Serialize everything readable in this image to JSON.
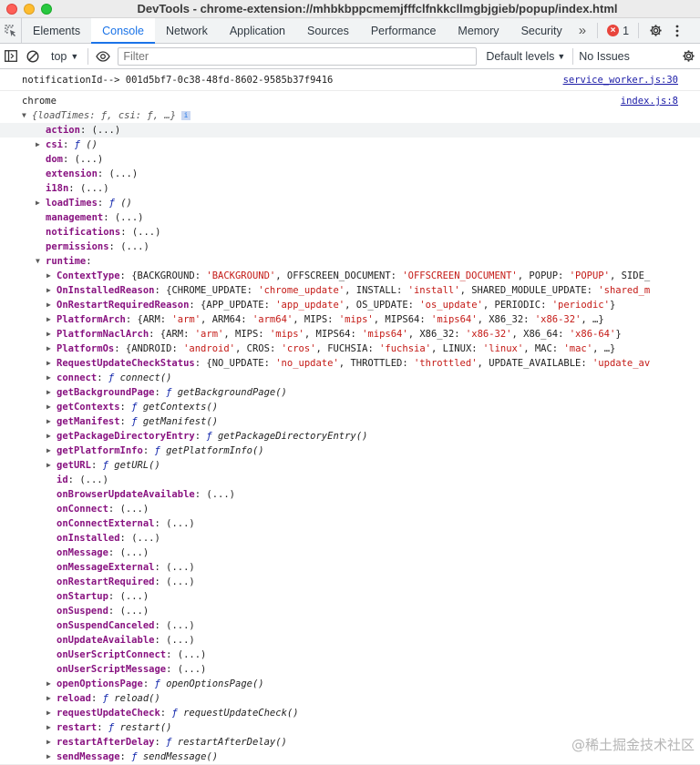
{
  "window": {
    "title": "DevTools - chrome-extension://mhbkbppcmemjfffclfnkkcllmgbjgieb/popup/index.html"
  },
  "tabs": {
    "items": [
      {
        "label": "Elements"
      },
      {
        "label": "Console"
      },
      {
        "label": "Network"
      },
      {
        "label": "Application"
      },
      {
        "label": "Sources"
      },
      {
        "label": "Performance"
      },
      {
        "label": "Memory"
      },
      {
        "label": "Security"
      }
    ],
    "more": "»",
    "error_count": "1"
  },
  "toolbar": {
    "context": "top",
    "filter_placeholder": "Filter",
    "levels": "Default levels",
    "issues": "No Issues"
  },
  "messages": [
    {
      "text": "notificationId--> 001d5bf7-0c38-48fd-8602-9585b37f9416",
      "source": "service_worker.js:30"
    },
    {
      "text": "chrome",
      "source": "index.js:8"
    }
  ],
  "object_summary": "{loadTimes: ƒ, csi: ƒ, …}",
  "chrome_props": [
    {
      "key": "action",
      "rest": ": (...)",
      "expandable": false
    },
    {
      "key": "csi",
      "rest": ": ƒ ()",
      "expandable": true,
      "fn": true
    },
    {
      "key": "dom",
      "rest": ": (...)",
      "expandable": false
    },
    {
      "key": "extension",
      "rest": ": (...)",
      "expandable": false
    },
    {
      "key": "i18n",
      "rest": ": (...)",
      "expandable": false
    },
    {
      "key": "loadTimes",
      "rest": ": ƒ ()",
      "expandable": true,
      "fn": true
    },
    {
      "key": "management",
      "rest": ": (...)",
      "expandable": false
    },
    {
      "key": "notifications",
      "rest": ": (...)",
      "expandable": false
    },
    {
      "key": "permissions",
      "rest": ": (...)",
      "expandable": false
    },
    {
      "key": "runtime",
      "rest": ":",
      "expandable": true,
      "open": true
    }
  ],
  "runtime_enums": [
    {
      "key": "ContextType",
      "pairs": [
        [
          "BACKGROUND",
          "'BACKGROUND'"
        ],
        [
          "OFFSCREEN_DOCUMENT",
          "'OFFSCREEN_DOCUMENT'"
        ],
        [
          "POPUP",
          "'POPUP'"
        ],
        [
          "SIDE_",
          ""
        ]
      ]
    },
    {
      "key": "OnInstalledReason",
      "pairs": [
        [
          "CHROME_UPDATE",
          "'chrome_update'"
        ],
        [
          "INSTALL",
          "'install'"
        ],
        [
          "SHARED_MODULE_UPDATE",
          "'shared_m"
        ]
      ]
    },
    {
      "key": "OnRestartRequiredReason",
      "pairs": [
        [
          "APP_UPDATE",
          "'app_update'"
        ],
        [
          "OS_UPDATE",
          "'os_update'"
        ],
        [
          "PERIODIC",
          "'periodic'"
        ]
      ],
      "close": "}"
    },
    {
      "key": "PlatformArch",
      "pairs": [
        [
          "ARM",
          "'arm'"
        ],
        [
          "ARM64",
          "'arm64'"
        ],
        [
          "MIPS",
          "'mips'"
        ],
        [
          "MIPS64",
          "'mips64'"
        ],
        [
          "X86_32",
          "'x86-32'"
        ]
      ],
      "close": ", …}"
    },
    {
      "key": "PlatformNaclArch",
      "pairs": [
        [
          "ARM",
          "'arm'"
        ],
        [
          "MIPS",
          "'mips'"
        ],
        [
          "MIPS64",
          "'mips64'"
        ],
        [
          "X86_32",
          "'x86-32'"
        ],
        [
          "X86_64",
          "'x86-64'"
        ]
      ],
      "close": "}"
    },
    {
      "key": "PlatformOs",
      "pairs": [
        [
          "ANDROID",
          "'android'"
        ],
        [
          "CROS",
          "'cros'"
        ],
        [
          "FUCHSIA",
          "'fuchsia'"
        ],
        [
          "LINUX",
          "'linux'"
        ],
        [
          "MAC",
          "'mac'"
        ]
      ],
      "close": ", …}"
    },
    {
      "key": "RequestUpdateCheckStatus",
      "pairs": [
        [
          "NO_UPDATE",
          "'no_update'"
        ],
        [
          "THROTTLED",
          "'throttled'"
        ],
        [
          "UPDATE_AVAILABLE",
          "'update_av"
        ]
      ]
    }
  ],
  "runtime_members": [
    {
      "key": "connect",
      "kind": "fn",
      "value": "connect()"
    },
    {
      "key": "getBackgroundPage",
      "kind": "fn",
      "value": "getBackgroundPage()"
    },
    {
      "key": "getContexts",
      "kind": "fn",
      "value": "getContexts()"
    },
    {
      "key": "getManifest",
      "kind": "fn",
      "value": "getManifest()"
    },
    {
      "key": "getPackageDirectoryEntry",
      "kind": "fn",
      "value": "getPackageDirectoryEntry()"
    },
    {
      "key": "getPlatformInfo",
      "kind": "fn",
      "value": "getPlatformInfo()"
    },
    {
      "key": "getURL",
      "kind": "fn",
      "value": "getURL()"
    },
    {
      "key": "id",
      "kind": "lazy"
    },
    {
      "key": "onBrowserUpdateAvailable",
      "kind": "lazy"
    },
    {
      "key": "onConnect",
      "kind": "lazy"
    },
    {
      "key": "onConnectExternal",
      "kind": "lazy"
    },
    {
      "key": "onInstalled",
      "kind": "lazy"
    },
    {
      "key": "onMessage",
      "kind": "lazy"
    },
    {
      "key": "onMessageExternal",
      "kind": "lazy"
    },
    {
      "key": "onRestartRequired",
      "kind": "lazy"
    },
    {
      "key": "onStartup",
      "kind": "lazy"
    },
    {
      "key": "onSuspend",
      "kind": "lazy"
    },
    {
      "key": "onSuspendCanceled",
      "kind": "lazy"
    },
    {
      "key": "onUpdateAvailable",
      "kind": "lazy"
    },
    {
      "key": "onUserScriptConnect",
      "kind": "lazy"
    },
    {
      "key": "onUserScriptMessage",
      "kind": "lazy"
    },
    {
      "key": "openOptionsPage",
      "kind": "fn",
      "value": "openOptionsPage()"
    },
    {
      "key": "reload",
      "kind": "fn",
      "value": "reload()"
    },
    {
      "key": "requestUpdateCheck",
      "kind": "fn",
      "value": "requestUpdateCheck()"
    },
    {
      "key": "restart",
      "kind": "fn",
      "value": "restart()"
    },
    {
      "key": "restartAfterDelay",
      "kind": "fn",
      "value": "restartAfterDelay()"
    },
    {
      "key": "sendMessage",
      "kind": "fn",
      "value": "sendMessage()"
    }
  ],
  "lazy_text": "(...)",
  "fn_mark": "ƒ",
  "watermark": "@稀土掘金技术社区",
  "colors": {
    "accent": "#1a73e8",
    "key": "#881280",
    "string": "#c41a16",
    "link": "#1a1aa6",
    "error": "#e8453c"
  }
}
